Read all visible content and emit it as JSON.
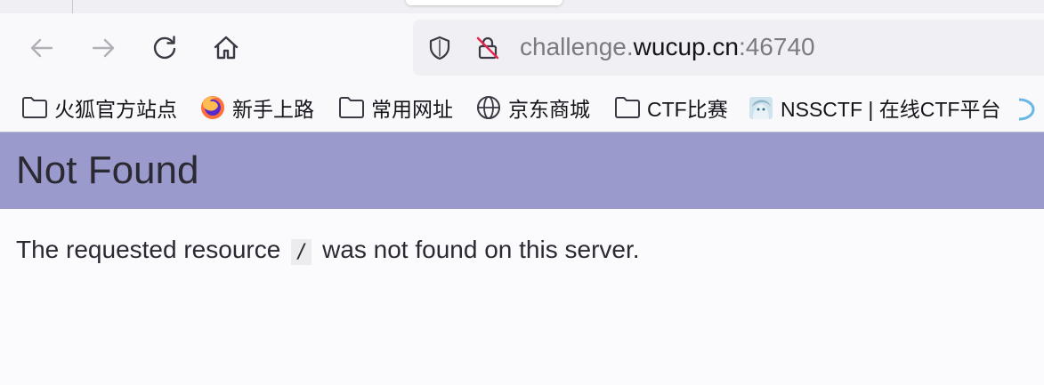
{
  "browser": {
    "toolbar": {
      "back_label": "Back",
      "forward_label": "Forward",
      "reload_label": "Reload",
      "home_label": "Home"
    },
    "urlbar": {
      "url_prefix": "challenge.",
      "url_domain": "wucup.cn",
      "url_port": ":46740"
    },
    "bookmarks": [
      {
        "label": "火狐官方站点",
        "icon": "folder-icon"
      },
      {
        "label": "新手上路",
        "icon": "firefox-icon"
      },
      {
        "label": "常用网址",
        "icon": "folder-icon"
      },
      {
        "label": "京东商城",
        "icon": "globe-icon"
      },
      {
        "label": "CTF比赛",
        "icon": "folder-icon"
      },
      {
        "label": "NSSCTF | 在线CTF平台",
        "icon": "nssctf-avatar-icon"
      }
    ]
  },
  "page": {
    "title": "Not Found",
    "message_before": "The requested resource",
    "message_code": "/",
    "message_after": "was not found on this server."
  },
  "colors": {
    "header_bg": "#9a9acd",
    "page_bg": "#fbfbfe",
    "text": "#2b2a33"
  }
}
